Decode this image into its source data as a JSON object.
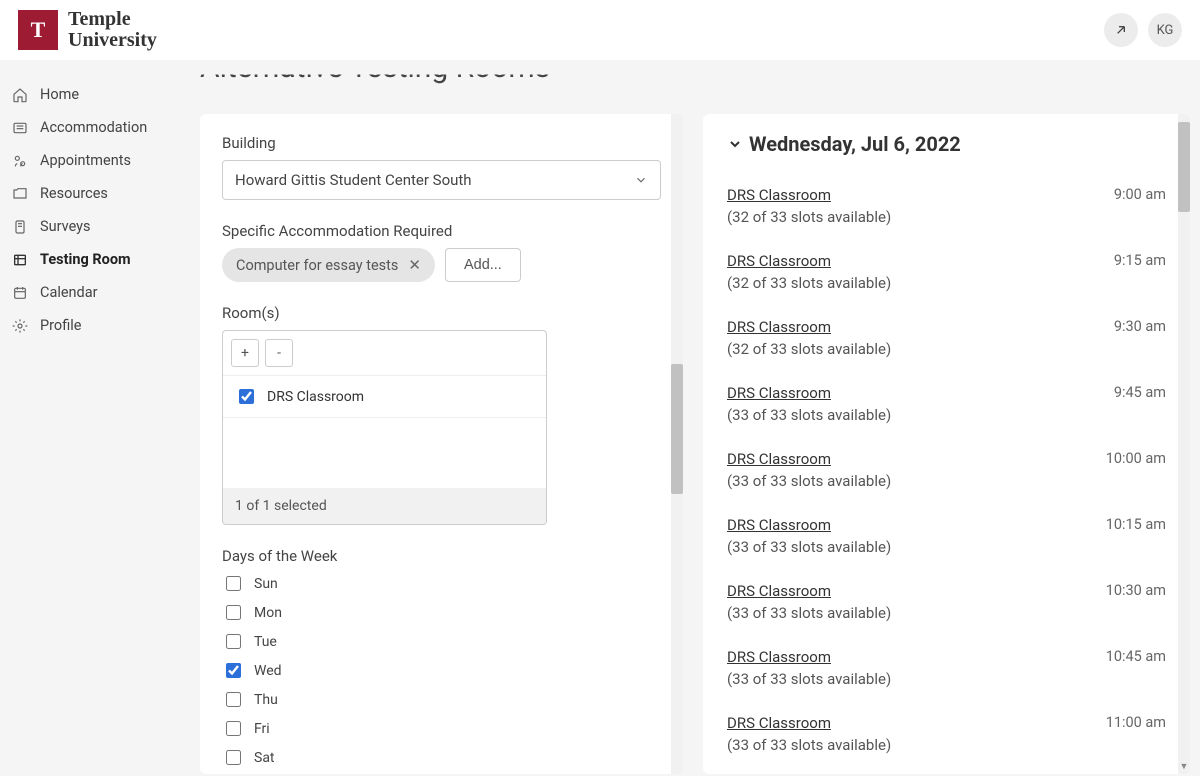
{
  "org": {
    "name_line1": "Temple",
    "name_line2": "University",
    "logo_letter": "T"
  },
  "user": {
    "initials": "KG"
  },
  "page_title": "Alternative Testing Rooms",
  "sidebar": {
    "items": [
      {
        "label": "Home"
      },
      {
        "label": "Accommodation"
      },
      {
        "label": "Appointments"
      },
      {
        "label": "Resources"
      },
      {
        "label": "Surveys"
      },
      {
        "label": "Testing Room"
      },
      {
        "label": "Calendar"
      },
      {
        "label": "Profile"
      }
    ],
    "active_index": 5
  },
  "filters": {
    "building": {
      "label": "Building",
      "value": "Howard Gittis Student Center South"
    },
    "accommodation": {
      "label": "Specific Accommodation Required",
      "chips": [
        "Computer for essay tests"
      ],
      "add_label": "Add..."
    },
    "rooms": {
      "label": "Room(s)",
      "items": [
        {
          "name": "DRS Classroom",
          "checked": true
        }
      ],
      "footer": "1 of 1 selected"
    },
    "days": {
      "label": "Days of the Week",
      "items": [
        {
          "label": "Sun",
          "checked": false
        },
        {
          "label": "Mon",
          "checked": false
        },
        {
          "label": "Tue",
          "checked": false
        },
        {
          "label": "Wed",
          "checked": true
        },
        {
          "label": "Thu",
          "checked": false
        },
        {
          "label": "Fri",
          "checked": false
        },
        {
          "label": "Sat",
          "checked": false
        }
      ]
    }
  },
  "results": {
    "date_label": "Wednesday, Jul 6, 2022",
    "slots": [
      {
        "room": "DRS Classroom",
        "avail": "(32 of 33 slots available)",
        "time": "9:00 am"
      },
      {
        "room": "DRS Classroom",
        "avail": "(32 of 33 slots available)",
        "time": "9:15 am"
      },
      {
        "room": "DRS Classroom",
        "avail": "(32 of 33 slots available)",
        "time": "9:30 am"
      },
      {
        "room": "DRS Classroom",
        "avail": "(33 of 33 slots available)",
        "time": "9:45 am"
      },
      {
        "room": "DRS Classroom",
        "avail": "(33 of 33 slots available)",
        "time": "10:00 am"
      },
      {
        "room": "DRS Classroom",
        "avail": "(33 of 33 slots available)",
        "time": "10:15 am"
      },
      {
        "room": "DRS Classroom",
        "avail": "(33 of 33 slots available)",
        "time": "10:30 am"
      },
      {
        "room": "DRS Classroom",
        "avail": "(33 of 33 slots available)",
        "time": "10:45 am"
      },
      {
        "room": "DRS Classroom",
        "avail": "(33 of 33 slots available)",
        "time": "11:00 am"
      }
    ]
  }
}
